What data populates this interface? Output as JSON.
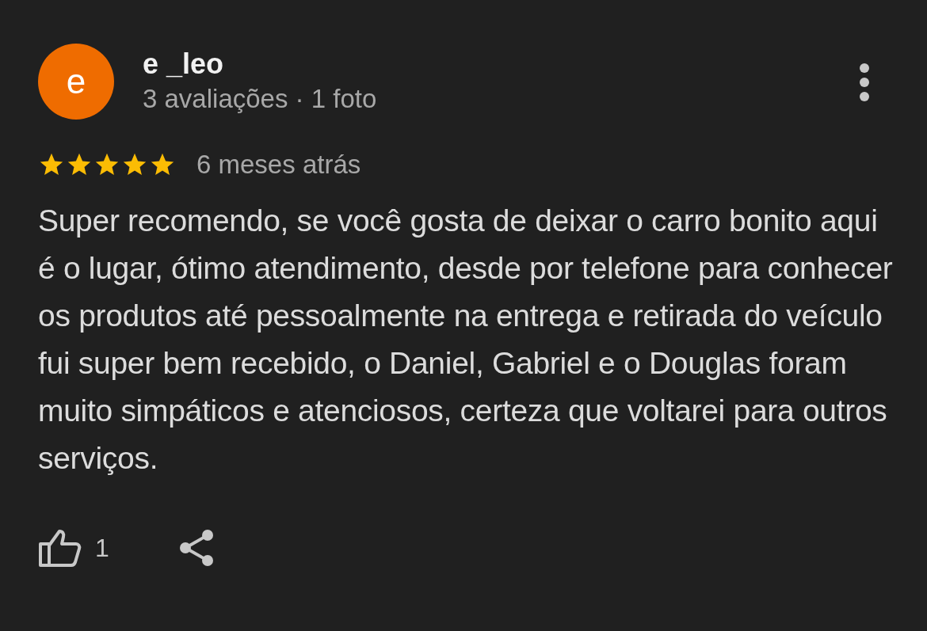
{
  "review": {
    "avatar_letter": "e",
    "author": "e _leo",
    "meta": "3 avaliações · 1 foto",
    "stars": 5,
    "time": "6 meses atrás",
    "text": "Super recomendo, se você gosta de deixar o carro bonito aqui é o lugar, ótimo atendimento, desde por telefone para conhecer os produtos até pessoalmente na entrega e retirada do veículo fui super bem recebido, o Daniel, Gabriel e o Douglas foram muito simpáticos e atenciosos, certeza que voltarei para outros serviços.",
    "likes": "1"
  }
}
